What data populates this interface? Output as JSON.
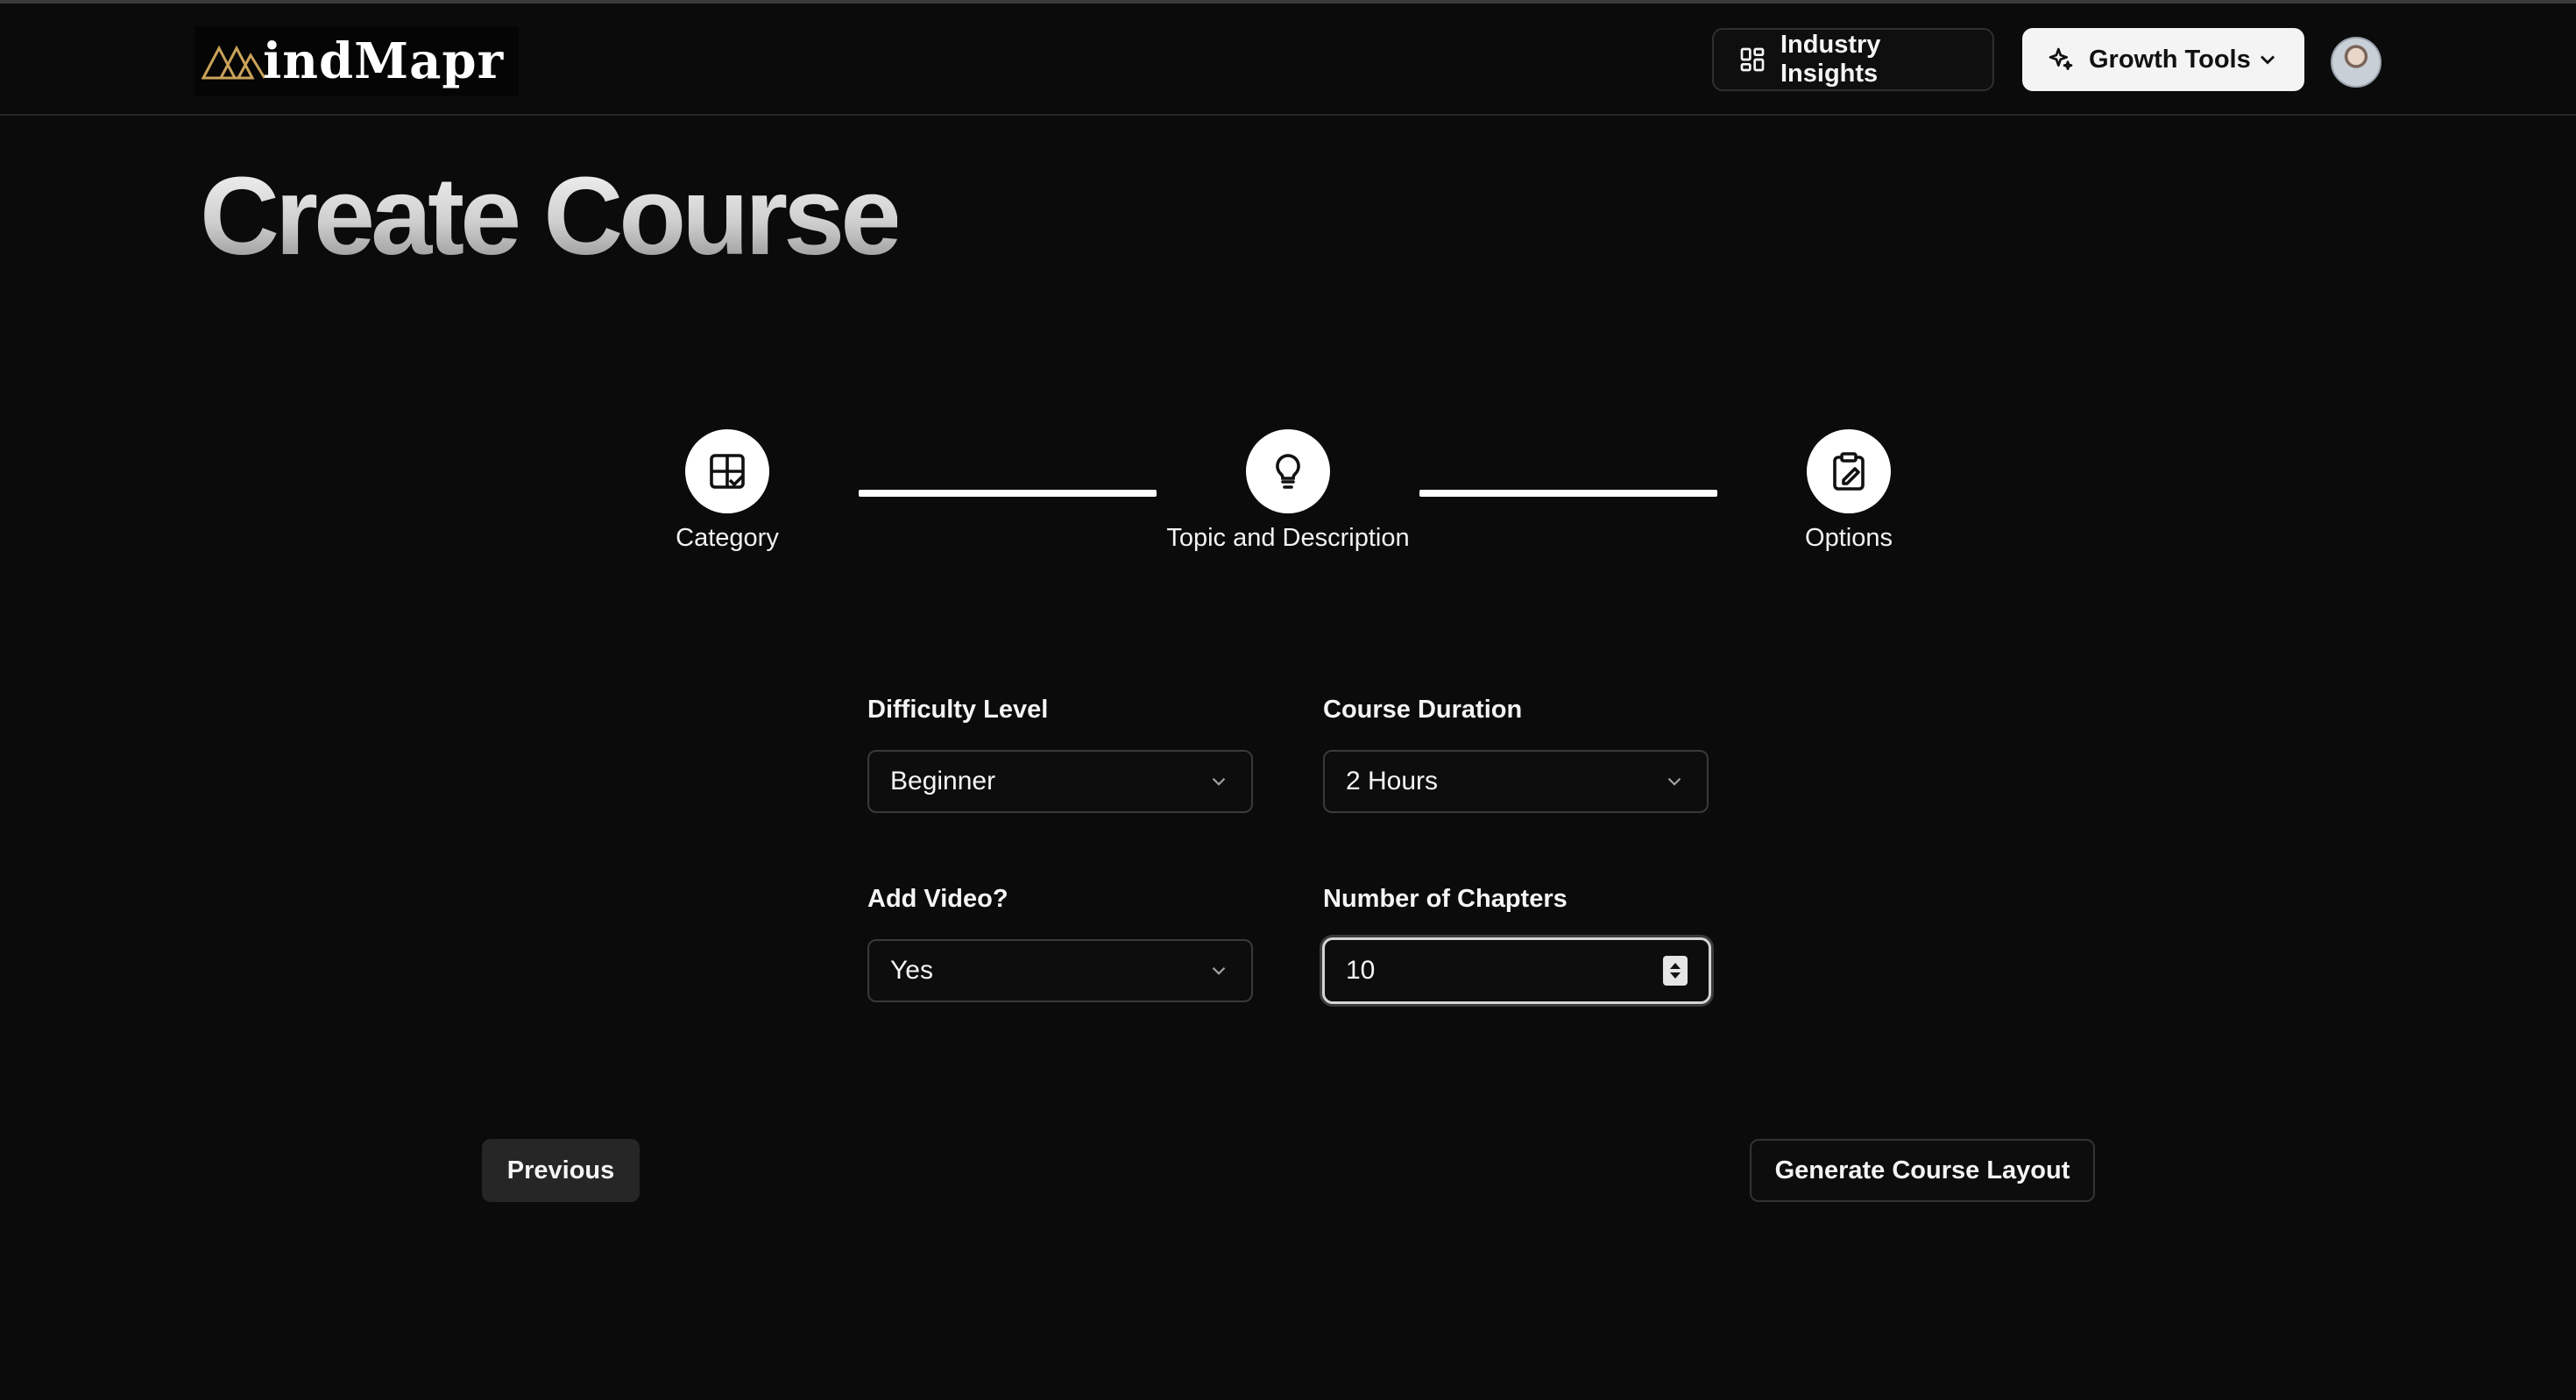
{
  "header": {
    "logo_text": "indMapr",
    "insights_label": "Industry Insights",
    "growth_label": "Growth Tools"
  },
  "page": {
    "title": "Create Course"
  },
  "stepper": {
    "steps": [
      {
        "label": "Category",
        "icon": "layout-check-icon"
      },
      {
        "label": "Topic and Description",
        "icon": "lightbulb-icon"
      },
      {
        "label": "Options",
        "icon": "clipboard-pen-icon"
      }
    ]
  },
  "form": {
    "difficulty": {
      "label": "Difficulty Level",
      "value": "Beginner"
    },
    "duration": {
      "label": "Course Duration",
      "value": "2 Hours"
    },
    "video": {
      "label": "Add Video?",
      "value": "Yes"
    },
    "chapters": {
      "label": "Number of Chapters",
      "value": "10"
    }
  },
  "actions": {
    "previous_label": "Previous",
    "generate_label": "Generate Course Layout"
  },
  "colors": {
    "background": "#0b0b0b",
    "logo_accent": "#c9a25a",
    "primary_button": "#f4f4f5"
  }
}
